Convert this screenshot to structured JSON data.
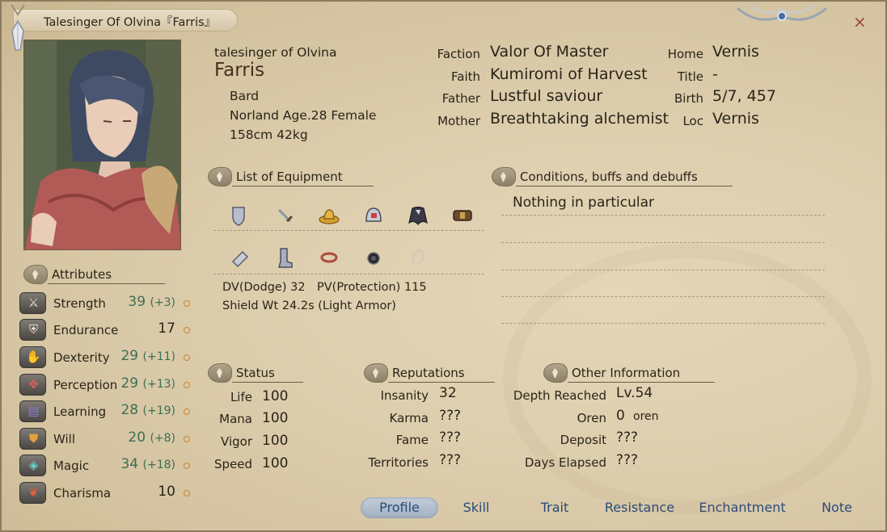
{
  "window": {
    "title": "Talesinger Of Olvina『Farris』",
    "close_label": "×"
  },
  "profile": {
    "alias": "talesinger of Olvina",
    "name": "Farris",
    "class": "Bard",
    "origin": "Norland Age.28 Female",
    "size": "158cm 42kg"
  },
  "bio": {
    "faction_label": "Faction",
    "faction": "Valor Of Master",
    "faith_label": "Faith",
    "faith": "Kumiromi of Harvest",
    "father_label": "Father",
    "father": "Lustful saviour",
    "mother_label": "Mother",
    "mother": "Breathtaking alchemist",
    "home_label": "Home",
    "home": "Vernis",
    "title_label": "Title",
    "title": "-",
    "birth_label": "Birth",
    "birth": "5/7, 457",
    "loc_label": "Loc",
    "loc": "Vernis"
  },
  "attributes": {
    "header": "Attributes",
    "items": [
      {
        "name": "Strength",
        "value": "39",
        "mod": "(+3)",
        "icon": "sword-icon"
      },
      {
        "name": "Endurance",
        "value": "17",
        "mod": "",
        "icon": "armor-icon"
      },
      {
        "name": "Dexterity",
        "value": "29",
        "mod": "(+11)",
        "icon": "hand-icon"
      },
      {
        "name": "Perception",
        "value": "29",
        "mod": "(+13)",
        "icon": "eye-icon"
      },
      {
        "name": "Learning",
        "value": "28",
        "mod": "(+19)",
        "icon": "book-icon"
      },
      {
        "name": "Will",
        "value": "20",
        "mod": "(+8)",
        "icon": "shield-icon"
      },
      {
        "name": "Magic",
        "value": "34",
        "mod": "(+18)",
        "icon": "rune-icon"
      },
      {
        "name": "Charisma",
        "value": "10",
        "mod": "",
        "icon": "heart-icon"
      }
    ]
  },
  "equipment": {
    "header": "List of Equipment",
    "icons": [
      "shield-icon",
      "dagger-icon",
      "hat-icon",
      "helmet-icon",
      "cloak-icon",
      "belt-icon",
      "bracer-icon",
      "boots-icon",
      "ring-icon",
      "amulet-icon",
      "empty-ring-icon"
    ],
    "dv": "DV(Dodge) 32",
    "pv": "PV(Protection) 115",
    "weight": "Shield Wt 24.2s (Light Armor)"
  },
  "conditions": {
    "header": "Conditions, buffs and debuffs",
    "text": "Nothing in particular"
  },
  "status": {
    "header": "Status",
    "items": [
      {
        "label": "Life",
        "value": "100"
      },
      {
        "label": "Mana",
        "value": "100"
      },
      {
        "label": "Vigor",
        "value": "100"
      },
      {
        "label": "Speed",
        "value": "100"
      }
    ]
  },
  "reputations": {
    "header": "Reputations",
    "items": [
      {
        "label": "Insanity",
        "value": "32"
      },
      {
        "label": "Karma",
        "value": "???"
      },
      {
        "label": "Fame",
        "value": "???"
      },
      {
        "label": "Territories",
        "value": "???"
      }
    ]
  },
  "other": {
    "header": "Other Information",
    "items": [
      {
        "label": "Depth Reached",
        "value": "Lv.54"
      },
      {
        "label": "Oren",
        "value": "0",
        "unit": "oren"
      },
      {
        "label": "Deposit",
        "value": "???"
      },
      {
        "label": "Days Elapsed",
        "value": "???"
      }
    ]
  },
  "tabs": [
    "Profile",
    "Skill",
    "Trait",
    "Resistance",
    "Enchantment",
    "Note"
  ],
  "colors": {
    "accent_mod": "#3c6e54",
    "tab_text": "#2a4a7a",
    "dot": "#d0842c"
  }
}
